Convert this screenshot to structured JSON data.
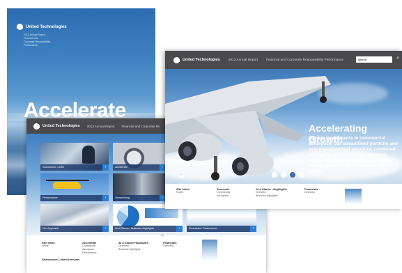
{
  "cover": {
    "brand": "United Technologies",
    "subtext_lines": [
      "2013 Annual Report",
      "Financial and",
      "Corporate Responsibility",
      "Performance"
    ],
    "headline": "Accelerate"
  },
  "front_page": {
    "brand": "United Technologies",
    "nav": [
      "2013 Annual Report",
      "Financial and Corporate Responsibility Performance"
    ],
    "search": {
      "value": "search",
      "button_icon": "⌕"
    },
    "hero": {
      "title": "Accelerating Growth",
      "text": "Our big investments in commercial aerospace, our streamlined portfolio and new organizational structure, combined with our global scale and organized leadership team, position us to deliver strong growth in 2013 and well into the future."
    },
    "footer_columns": [
      {
        "heading": "Site Index",
        "items": [
          "Home"
        ]
      },
      {
        "heading": "Acclerate",
        "items": [
          "Commercial",
          "Aerospace"
        ]
      },
      {
        "heading": "At a Glance / Highlights",
        "items": [
          "Overview",
          "Business Highlights"
        ]
      },
      {
        "heading": "Financials",
        "items": [
          "Overview"
        ]
      }
    ]
  },
  "back_page": {
    "brand": "United Technologies",
    "nav": [
      "2013 Annual Report",
      "Financial and Corporate Re"
    ],
    "tiles": [
      {
        "caption": "Shareowner Letter",
        "arrow": "›"
      },
      {
        "caption": "Accelerate",
        "arrow": "›"
      },
      {
        "caption": "Performance",
        "arrow": "›"
      },
      {
        "caption": "Streamlining",
        "arrow": "›"
      },
      {
        "caption": "Our Approach",
        "arrow": "›"
      },
      {
        "caption": "At a Glance / Business Highlights",
        "arrow": "›"
      },
      {
        "caption": "Financials / Shareowner",
        "arrow": "›"
      }
    ],
    "footer_columns": [
      {
        "heading": "Site Index",
        "items": [
          "Home"
        ]
      },
      {
        "heading": "Accelerate",
        "items": [
          "Commercial",
          "Aerospace",
          "Performance"
        ]
      },
      {
        "heading": "At a Glance Highlights",
        "items": [
          "Overview",
          "Business Highlights"
        ]
      },
      {
        "heading": "Financials",
        "items": [
          "Overview"
        ]
      },
      {
        "heading": "Shareowner Letter/Overview",
        "items": []
      }
    ]
  },
  "colors": {
    "topbar": "#4a4a4c",
    "accent_blue": "#2f7dd1",
    "active_dot": "#3d6ea3"
  }
}
